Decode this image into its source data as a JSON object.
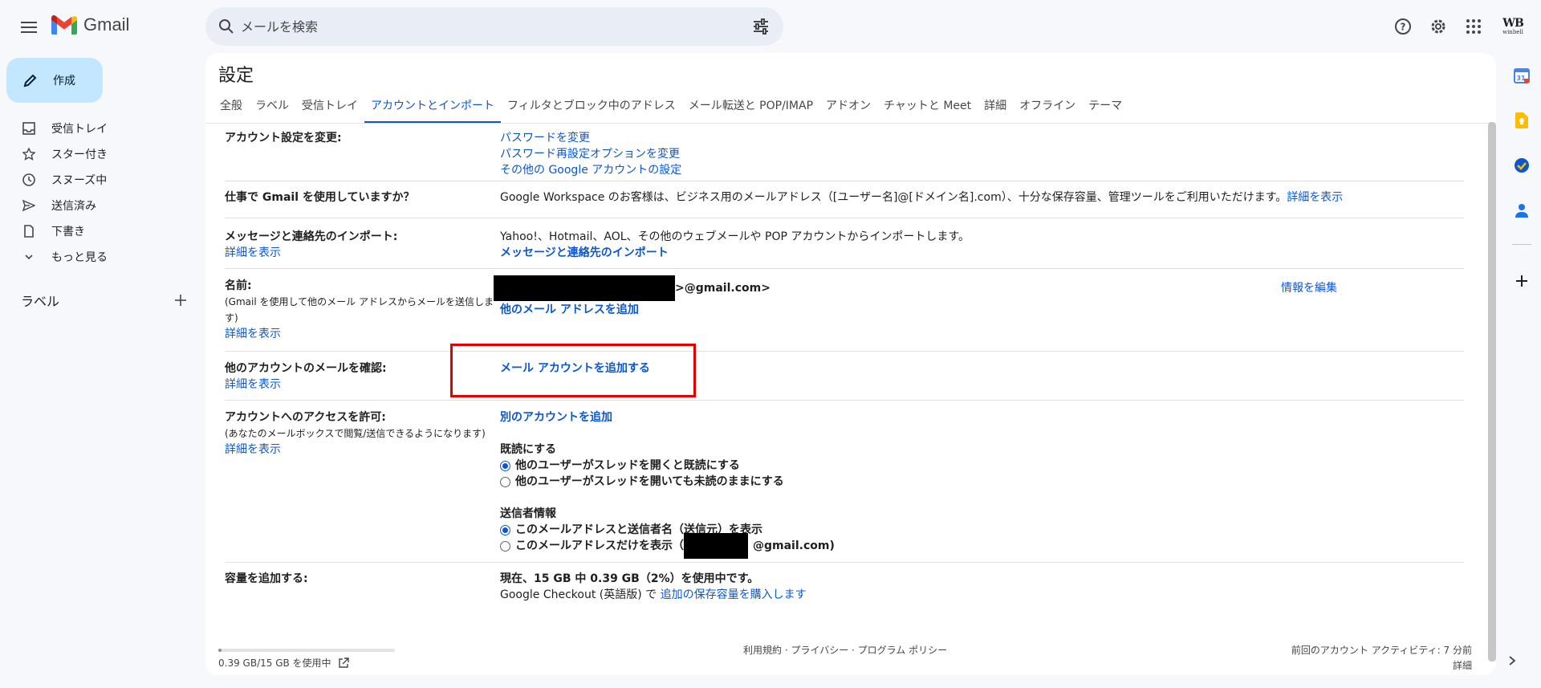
{
  "app": {
    "logo_text": "Gmail",
    "account_mark": "WB",
    "account_text": "winbell"
  },
  "search": {
    "placeholder": "メールを検索"
  },
  "compose": {
    "label": "作成"
  },
  "nav": {
    "items": [
      {
        "label": "受信トレイ",
        "icon": "inbox-icon"
      },
      {
        "label": "スター付き",
        "icon": "star-icon"
      },
      {
        "label": "スヌーズ中",
        "icon": "clock-icon"
      },
      {
        "label": "送信済み",
        "icon": "send-icon"
      },
      {
        "label": "下書き",
        "icon": "file-icon"
      },
      {
        "label": "もっと見る",
        "icon": "chevron-down-icon"
      }
    ],
    "labels_heading": "ラベル"
  },
  "settings": {
    "title": "設定",
    "tabs": [
      {
        "label": "全般"
      },
      {
        "label": "ラベル"
      },
      {
        "label": "受信トレイ"
      },
      {
        "label": "アカウントとインポート",
        "active": true
      },
      {
        "label": "フィルタとブロック中のアドレス"
      },
      {
        "label": "メール転送と POP/IMAP"
      },
      {
        "label": "アドオン"
      },
      {
        "label": "チャットと Meet"
      },
      {
        "label": "詳細"
      },
      {
        "label": "オフライン"
      },
      {
        "label": "テーマ"
      }
    ],
    "detail_link": "詳細を表示",
    "rows": {
      "account": {
        "label": "アカウント設定を変更:",
        "links": [
          "パスワードを変更",
          "パスワード再設定オプションを変更",
          "その他の Google アカウントの設定"
        ]
      },
      "workspace": {
        "label": "仕事で Gmail を使用していますか？",
        "text": "Google Workspace のお客様は、ビジネス用のメールアドレス（[ユーザー名]@[ドメイン名].com）、十分な保存容量、管理ツールをご利用いただけます。",
        "link": "詳細を表示"
      },
      "import": {
        "label": "メッセージと連絡先のインポート:",
        "text": "Yahoo!、Hotmail、AOL、その他のウェブメールや POP アカウントからインポートします。",
        "link": "メッセージと連絡先のインポート"
      },
      "name": {
        "label": "名前:",
        "sub": "(Gmail を使用して他のメール アドレスからメールを送信します)",
        "email_suffix": ">@gmail.com>",
        "add_link": "他のメール アドレスを追加",
        "edit_link": "情報を編集"
      },
      "check_mail": {
        "label": "他のアカウントのメールを確認:",
        "link": "メール アカウントを追加する"
      },
      "grant_access": {
        "label": "アカウントへのアクセスを許可:",
        "sub": "(あなたのメールボックスで閲覧/送信できるようになります)",
        "link": "別のアカウントを追加",
        "read_heading": "既読にする",
        "read_options": [
          "他のユーザーがスレッドを開くと既読にする",
          "他のユーザーがスレッドを開いても未読のままにする"
        ],
        "sender_heading": "送信者情報",
        "sender_options": [
          "このメールアドレスと送信者名（送信元）を表示",
          "このメールアドレスだけを表示（"
        ],
        "sender_suffix": "@gmail.com)"
      },
      "storage": {
        "label": "容量を追加する:",
        "usage": "現在、15 GB 中 0.39 GB（2%）を使用中です。",
        "checkout_prefix": "Google Checkout (英語版) で",
        "checkout_link": "追加の保存容量を購入します"
      }
    }
  },
  "footer": {
    "storage_text": "0.39 GB/15 GB を使用中",
    "storage_percent": 2,
    "links": "利用規約 · プライバシー · プログラム ポリシー",
    "activity": "前回のアカウント アクティビティ: 7 分前",
    "details": "詳細"
  },
  "colors": {
    "accent": "#0b57d0",
    "compose_bg": "#c2e7ff",
    "highlight": "#e00000"
  }
}
